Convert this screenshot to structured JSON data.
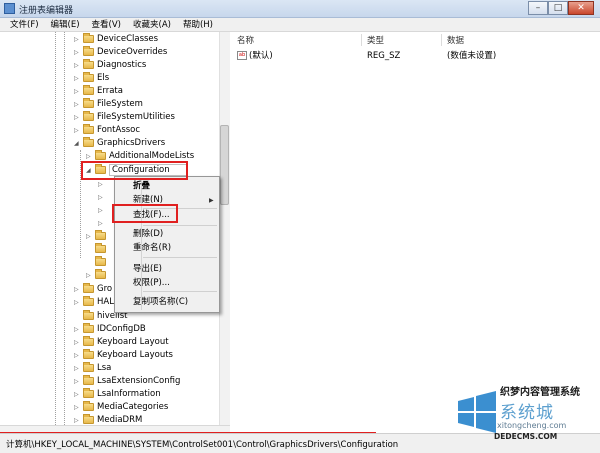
{
  "window": {
    "title": "注册表编辑器",
    "min": "–",
    "max": "□",
    "close": "✕"
  },
  "menubar": [
    "文件(F)",
    "编辑(E)",
    "查看(V)",
    "收藏夹(A)",
    "帮助(H)"
  ],
  "tree": {
    "nodes": [
      "DeviceClasses",
      "DeviceOverrides",
      "Diagnostics",
      "Els",
      "Errata",
      "FileSystem",
      "FileSystemUtilities",
      "FontAssoc",
      "GraphicsDrivers",
      "AdditionalModeLists",
      "Configuration",
      "Gro",
      "HAL",
      "hivelist",
      "IDConfigDB",
      "Keyboard Layout",
      "Keyboard Layouts",
      "Lsa",
      "LsaExtensionConfig",
      "LsaInformation",
      "MediaCategories",
      "MediaDRM"
    ],
    "selected": "Configuration"
  },
  "list": {
    "columns": [
      "名称",
      "类型",
      "数据"
    ],
    "rows": [
      {
        "name": "(默认)",
        "type": "REG_SZ",
        "data": "(数值未设置)",
        "icon": "ab"
      }
    ]
  },
  "context_menu": {
    "items": [
      "折叠",
      "新建(N)",
      "查找(F)...",
      "删除(D)",
      "重命名(R)",
      "导出(E)",
      "权限(P)...",
      "复制项名称(C)"
    ],
    "submenu_arrow": "▶"
  },
  "statusbar": {
    "path": "计算机\\HKEY_LOCAL_MACHINE\\SYSTEM\\ControlSet001\\Control\\GraphicsDrivers\\Configuration"
  },
  "watermark": {
    "line1": "织梦内容管理系统",
    "line2": "系统城",
    "line3": "xitongcheng.com",
    "line4": "DEDECMS.COM"
  },
  "colors": {
    "highlight": "#e02020",
    "titlebar": "#c7d7ec",
    "folder": "#e7b84a"
  }
}
